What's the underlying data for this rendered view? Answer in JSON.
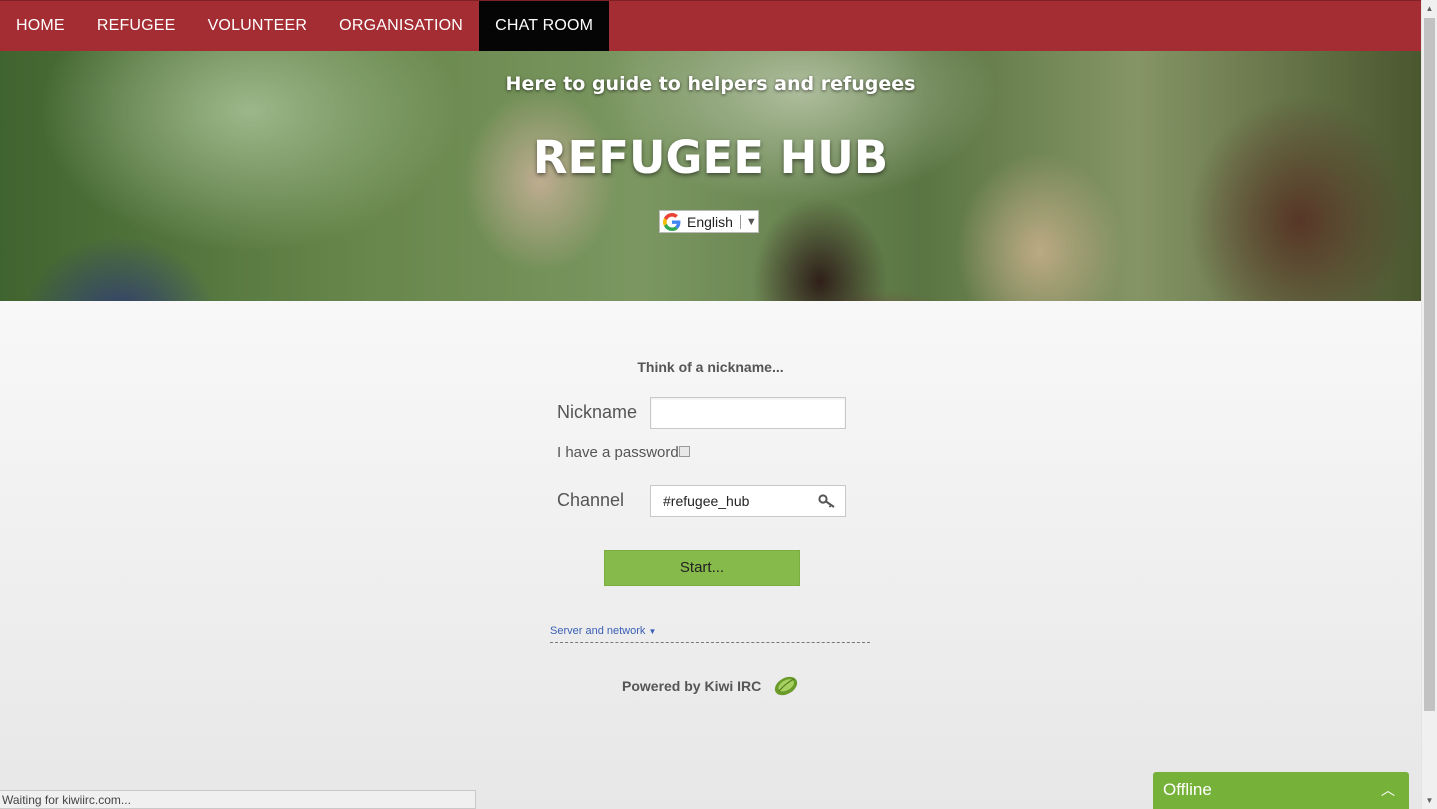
{
  "nav": {
    "items": [
      {
        "label": "HOME"
      },
      {
        "label": "REFUGEE"
      },
      {
        "label": "VOLUNTEER"
      },
      {
        "label": "ORGANISATION"
      },
      {
        "label": "CHAT ROOM",
        "active": true
      }
    ]
  },
  "hero": {
    "subtitle": "Here to guide to helpers and refugees",
    "title": "REFUGEE HUB",
    "language": {
      "selected": "English",
      "icon": "google-icon"
    }
  },
  "form": {
    "heading": "Think of a nickname...",
    "nickname_label": "Nickname",
    "nickname_value": "",
    "password_label": "I have a password",
    "password_checked": false,
    "channel_label": "Channel",
    "channel_value": "#refugee_hub",
    "channel_icon": "key-icon",
    "start_label": "Start...",
    "server_link": "Server and network",
    "powered_by": "Powered by Kiwi IRC"
  },
  "status_bar": {
    "text": "Waiting for kiwiirc.com..."
  },
  "chat_widget": {
    "label": "Offline",
    "icon": "chevron-up-icon"
  },
  "colors": {
    "nav_bg": "#a32d33",
    "nav_active": "#050505",
    "start_button": "#86ba4b",
    "offline_widget": "#76b13a",
    "link": "#3a5fb5"
  }
}
